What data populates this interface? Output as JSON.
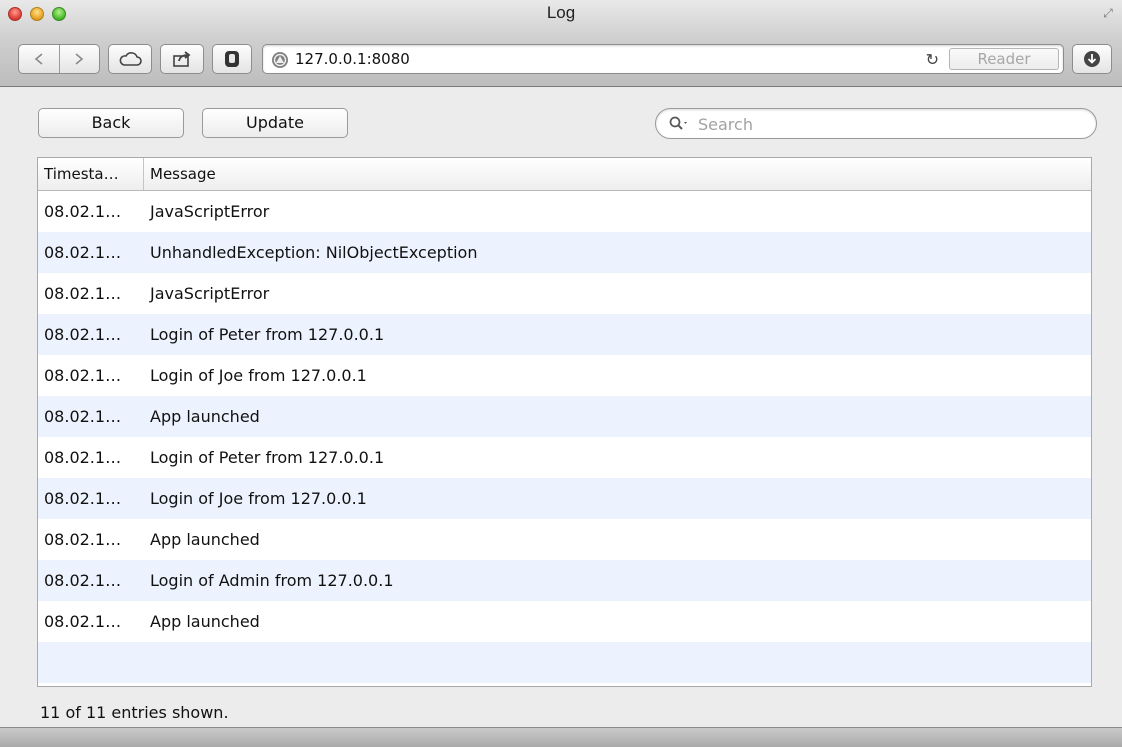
{
  "window": {
    "title": "Log"
  },
  "toolbar": {
    "url": "127.0.0.1:8080",
    "reader_label": "Reader"
  },
  "page": {
    "back_label": "Back",
    "update_label": "Update",
    "search_placeholder": "Search",
    "columns": {
      "timestamp": "Timesta…",
      "message": "Message"
    },
    "rows": [
      {
        "ts": "08.02.1…",
        "msg": "JavaScriptError"
      },
      {
        "ts": "08.02.1…",
        "msg": "UnhandledException: NilObjectException"
      },
      {
        "ts": "08.02.1…",
        "msg": "JavaScriptError"
      },
      {
        "ts": "08.02.1…",
        "msg": "Login of Peter from 127.0.0.1"
      },
      {
        "ts": "08.02.1…",
        "msg": "Login of Joe from 127.0.0.1"
      },
      {
        "ts": "08.02.1…",
        "msg": "App launched"
      },
      {
        "ts": "08.02.1…",
        "msg": "Login of Peter from 127.0.0.1"
      },
      {
        "ts": "08.02.1…",
        "msg": "Login of Joe from 127.0.0.1"
      },
      {
        "ts": "08.02.1…",
        "msg": "App launched"
      },
      {
        "ts": "08.02.1…",
        "msg": "Login of Admin from 127.0.0.1"
      },
      {
        "ts": "08.02.1…",
        "msg": "App launched"
      },
      {
        "ts": "",
        "msg": ""
      }
    ],
    "status": "11 of 11 entries shown."
  },
  "icons": {
    "close": "close-icon",
    "minimize": "minimize-icon",
    "zoom": "zoom-icon",
    "back": "back-arrow-icon",
    "forward": "forward-arrow-icon",
    "cloud": "cloud-icon",
    "share": "share-icon",
    "plugin": "hand-icon",
    "site": "site-icon",
    "reload": "reload-icon",
    "download": "download-icon",
    "search": "magnifier-icon",
    "fullscreen": "fullscreen-icon"
  },
  "colors": {
    "row_stripe": "#edf3fe",
    "close": "#e0443b",
    "minimize": "#e9a72b",
    "zoom": "#4fbf32"
  }
}
